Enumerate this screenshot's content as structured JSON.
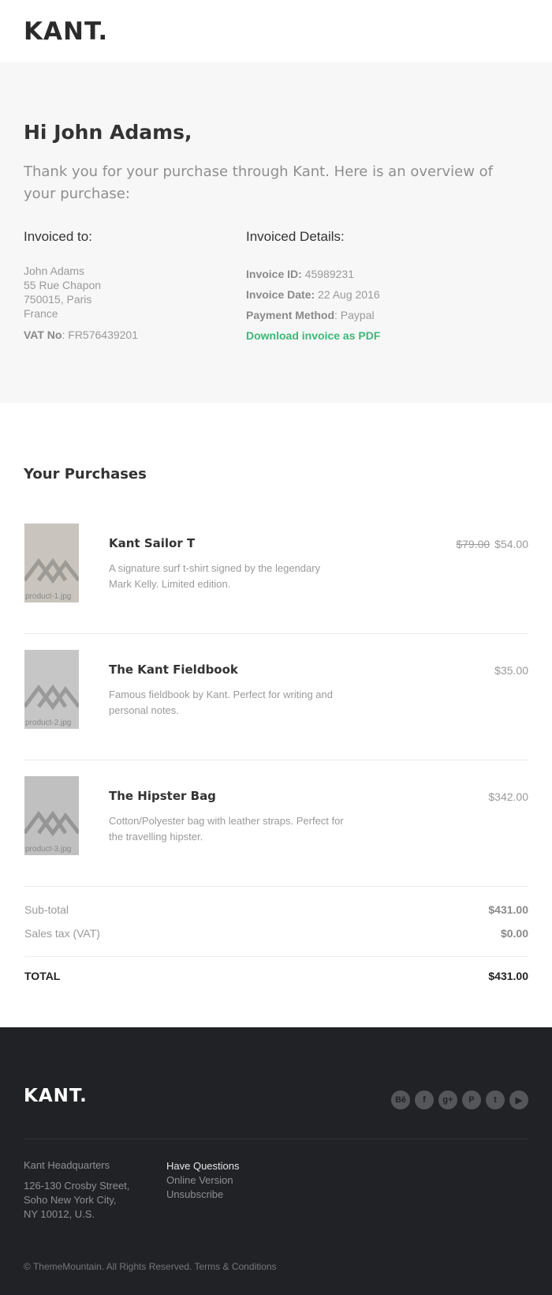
{
  "header": {
    "logo": "KANT."
  },
  "intro": {
    "greeting": "Hi John Adams,",
    "text": "Thank you for your purchase through Kant. Here is an overview of your purchase:"
  },
  "invoiced_to": {
    "title": "Invoiced to:",
    "address": [
      "John Adams",
      "55 Rue Chapon",
      "750015, Paris",
      "France"
    ],
    "vat_label": "VAT No",
    "vat_value": ": FR576439201"
  },
  "invoice_details": {
    "title": "Invoiced Details:",
    "id_label": "Invoice ID:",
    "id_value": " 45989231",
    "date_label": "Invoice Date:",
    "date_value": " 22 Aug 2016",
    "payment_label": "Payment Method",
    "payment_value": ": Paypal",
    "pdf_link": "Download invoice as PDF"
  },
  "purchases": {
    "title": "Your Purchases",
    "items": [
      {
        "thumb_label": "product-1.jpg",
        "name": "Kant Sailor T",
        "description": "A signature surf t-shirt signed by the legendary Mark Kelly. Limited edition.",
        "old_price": "$79.00",
        "price": "$54.00"
      },
      {
        "thumb_label": "product-2.jpg",
        "name": "The Kant Fieldbook",
        "description": "Famous fieldbook by Kant. Perfect for writing and personal notes.",
        "old_price": "",
        "price": "$35.00"
      },
      {
        "thumb_label": "product-3.jpg",
        "name": "The Hipster Bag",
        "description": "Cotton/Polyester bag with leather straps. Perfect for the travelling hipster.",
        "old_price": "",
        "price": "$342.00"
      }
    ]
  },
  "totals": {
    "subtotal_label": "Sub-total",
    "subtotal_value": "$431.00",
    "tax_label": "Sales tax (VAT)",
    "tax_value": "$0.00",
    "total_label": "TOTAL",
    "total_value": "$431.00"
  },
  "footer": {
    "logo": "KANT.",
    "socials": [
      {
        "icon": "behance-icon",
        "glyph": "Bē"
      },
      {
        "icon": "facebook-icon",
        "glyph": "f"
      },
      {
        "icon": "google-plus-icon",
        "glyph": "g+"
      },
      {
        "icon": "pinterest-icon",
        "glyph": "P"
      },
      {
        "icon": "twitter-icon",
        "glyph": "t"
      },
      {
        "icon": "youtube-icon",
        "glyph": "▶"
      }
    ],
    "hq_title": "Kant Headquarters",
    "hq_address": [
      "126-130 Crosby Street,",
      "Soho New York City,",
      "NY 10012, U.S."
    ],
    "questions_title": "Have Questions",
    "online_version": "Online Version",
    "unsubscribe": "Unsubscribe",
    "copyright": "© ThemeMountain. All Rights Reserved. Terms & Conditions"
  },
  "colors": {
    "accent_green": "#3cb878",
    "footer_bg": "#212225",
    "intro_bg": "#f7f7f7",
    "thumb_1": "#c9c4bd",
    "thumb_2": "#c6c6c6",
    "thumb_3": "#c0c0c0"
  }
}
